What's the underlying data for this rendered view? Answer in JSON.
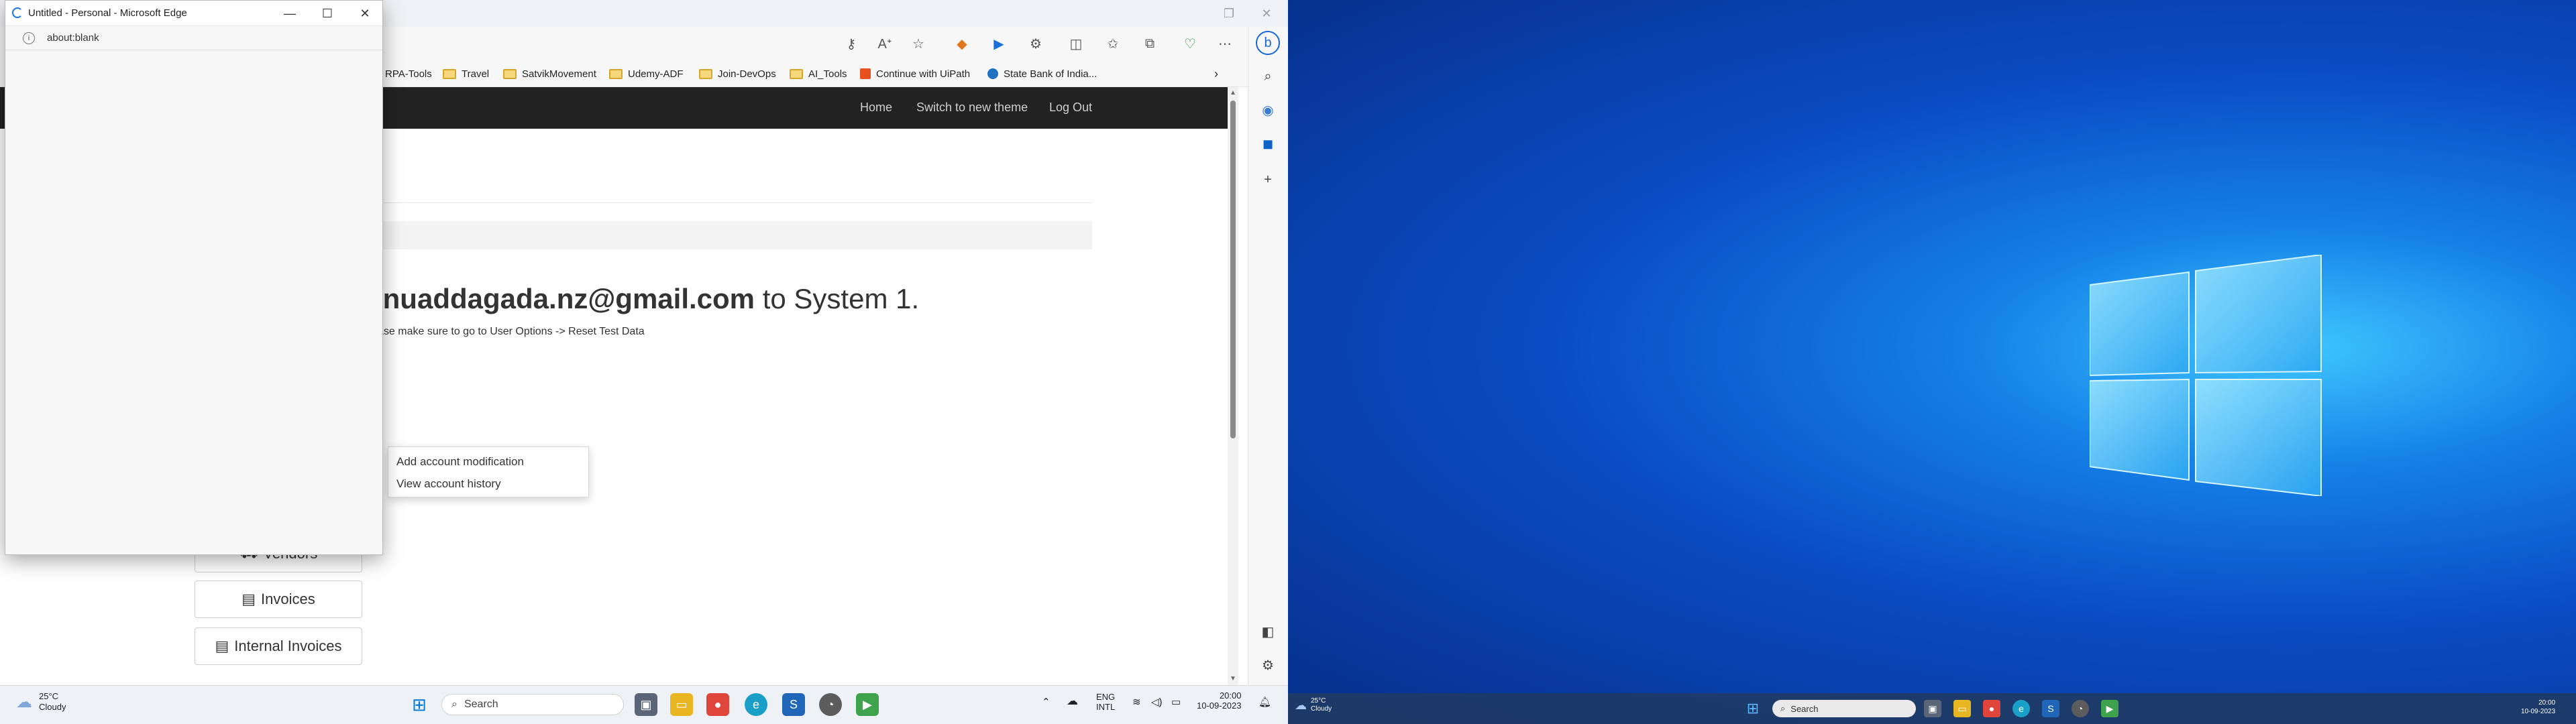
{
  "popup": {
    "title": "Untitled - Personal - Microsoft Edge",
    "url": "about:blank"
  },
  "favorites": [
    "RPA-Tools",
    "Travel",
    "SatvikMovement",
    "Udemy-ADF",
    "Join-DevOps",
    "AI_Tools",
    "Continue with UiPath",
    "State Bank of India..."
  ],
  "page": {
    "nav": {
      "home": "Home",
      "theme": "Switch to new theme",
      "logout": "Log Out"
    },
    "welcome_email": "hnuaddagada.nz@gmail.com",
    "welcome_rest": "to System 1.",
    "hint": "ase make sure to go to User Options -> Reset Test Data",
    "side_buttons": [
      {
        "label": "Vendors",
        "icon": "truck-icon"
      },
      {
        "label": "Invoices",
        "icon": "document-icon"
      },
      {
        "label": "Internal Invoices",
        "icon": "document-icon"
      }
    ],
    "context_menu": [
      "Add account modification",
      "View account history"
    ]
  },
  "taskbar_left": {
    "weather_temp": "25°C",
    "weather_desc": "Cloudy",
    "search_placeholder": "Search",
    "lang1": "ENG",
    "lang2": "INTL",
    "time": "20:00",
    "date": "10-09-2023"
  },
  "taskbar_right": {
    "weather_temp": "25°C",
    "weather_desc": "Cloudy",
    "search_placeholder": "Search",
    "time": "20:00",
    "date": "10-09-2023"
  },
  "colors": {
    "page_nav": "#222222",
    "desktop_blue": "#0a4cc4",
    "win_accent": "#0078d4"
  }
}
